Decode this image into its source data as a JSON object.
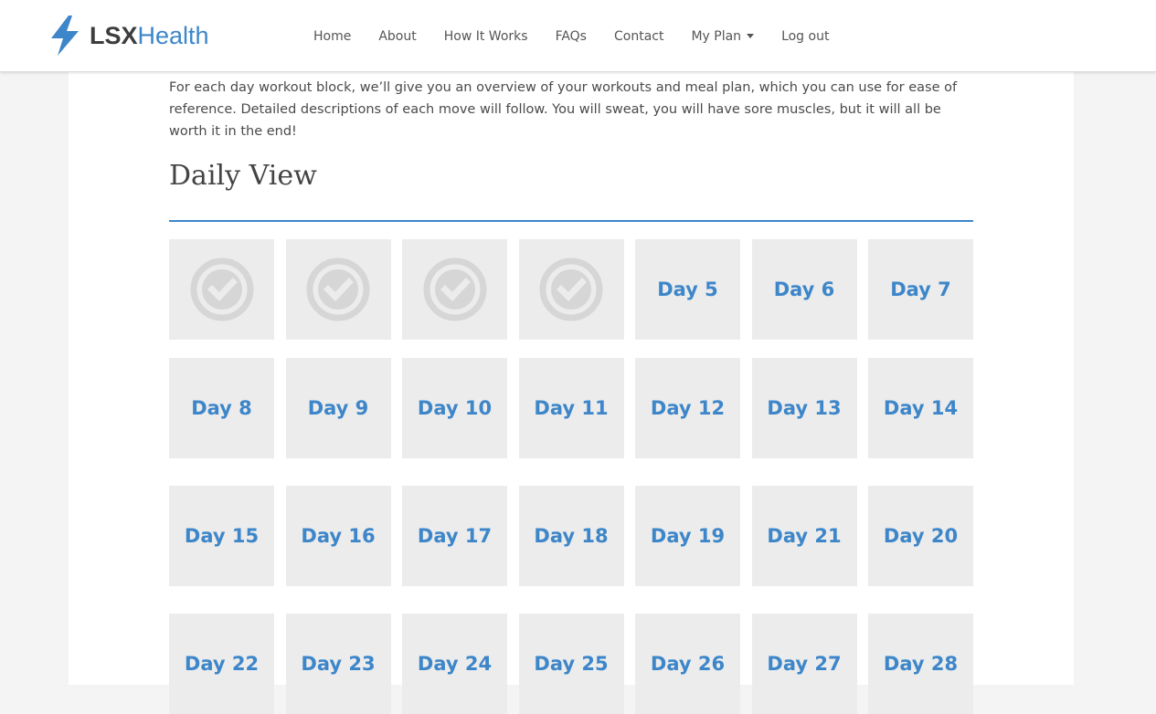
{
  "brand": {
    "name_bold": "LSX",
    "name_light": "Health",
    "icon": "lightning-bolt-icon",
    "accent_color": "#3d86c9"
  },
  "nav": {
    "items": [
      {
        "label": "Home"
      },
      {
        "label": "About"
      },
      {
        "label": "How It Works"
      },
      {
        "label": "FAQs"
      },
      {
        "label": "Contact"
      },
      {
        "label": "My Plan",
        "dropdown": true
      },
      {
        "label": "Log out"
      }
    ]
  },
  "main": {
    "intro": "For each day workout block, we’ll give you an overview of your workouts and meal plan, which you can use for ease of reference. Detailed descriptions of each move will follow. You will sweat, you will have sore muscles, but it will all be worth it in the end!",
    "section_title": "Daily View",
    "rows": [
      [
        {
          "completed": true,
          "icon": "check-circle-icon"
        },
        {
          "completed": true,
          "icon": "check-circle-icon"
        },
        {
          "completed": true,
          "icon": "check-circle-icon"
        },
        {
          "completed": true,
          "icon": "check-circle-icon"
        },
        {
          "label": "Day 5"
        },
        {
          "label": "Day 6"
        },
        {
          "label": "Day 7"
        }
      ],
      [
        {
          "label": "Day 8"
        },
        {
          "label": "Day 9"
        },
        {
          "label": "Day 10"
        },
        {
          "label": "Day 11"
        },
        {
          "label": "Day 12"
        },
        {
          "label": "Day 13"
        },
        {
          "label": "Day 14"
        }
      ],
      [
        {
          "label": "Day 15"
        },
        {
          "label": "Day 16"
        },
        {
          "label": "Day 17"
        },
        {
          "label": "Day 18"
        },
        {
          "label": "Day 19"
        },
        {
          "label": "Day 21"
        },
        {
          "label": "Day 20"
        }
      ],
      [
        {
          "label": "Day 22"
        },
        {
          "label": "Day 23"
        },
        {
          "label": "Day 24"
        },
        {
          "label": "Day 25"
        },
        {
          "label": "Day 26"
        },
        {
          "label": "Day 27"
        },
        {
          "label": "Day 28"
        }
      ]
    ]
  }
}
